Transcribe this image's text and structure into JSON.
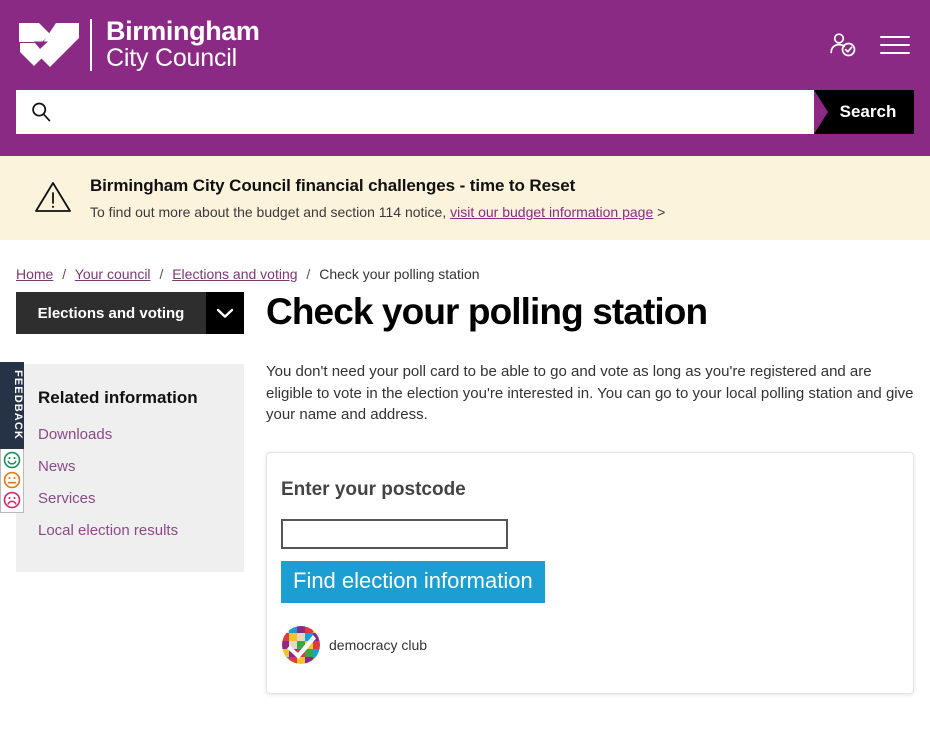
{
  "header": {
    "logo_name": "birmingham-city-council-logo",
    "brand_line1": "Birmingham",
    "brand_line2": "City Council",
    "account_icon": "user-verified-icon",
    "menu_icon": "hamburger-menu-icon"
  },
  "search": {
    "icon": "search-icon",
    "value": "",
    "placeholder": "",
    "button_label": "Search"
  },
  "alert": {
    "icon": "warning-triangle-icon",
    "title": "Birmingham City Council financial challenges - time to Reset",
    "text": "To find out more about the budget and section 114 notice,",
    "link_label": "visit our budget information page",
    "chevron": ">"
  },
  "breadcrumb": {
    "items": [
      {
        "label": "Home",
        "link": true
      },
      {
        "label": "Your council",
        "link": true
      },
      {
        "label": "Elections and voting",
        "link": true
      },
      {
        "label": "Check your polling station",
        "link": false
      }
    ],
    "separator": "/"
  },
  "sidebar": {
    "dropdown": {
      "label": "Elections and voting",
      "toggle_icon": "chevron-down-icon"
    },
    "related": {
      "heading": "Related information",
      "items": [
        {
          "label": "Downloads"
        },
        {
          "label": "News"
        },
        {
          "label": "Services"
        },
        {
          "label": "Local election results"
        }
      ]
    }
  },
  "main": {
    "title": "Check your polling station",
    "intro": "You don't need your poll card to be able to go and vote as long as you're registered and are eligible to vote in the election you're interested in.  You can go to your local polling station and give your name and address.",
    "form": {
      "title": "Enter your postcode",
      "postcode_value": "",
      "postcode_placeholder": "",
      "submit_label": "Find election information",
      "attribution": {
        "logo_name": "democracy-club-logo",
        "label": "democracy club"
      }
    }
  },
  "feedback": {
    "label": "FEEDBACK",
    "faces": [
      {
        "name": "happy-face-icon",
        "color": "#1c8c5a"
      },
      {
        "name": "neutral-face-icon",
        "color": "#e2761a"
      },
      {
        "name": "sad-face-icon",
        "color": "#cf2a6e"
      }
    ]
  },
  "colors": {
    "brand_purple": "#8a2a84",
    "alert_bg": "#fcf3dd",
    "button_blue": "#1b9ed2",
    "sidebar_bg": "#efefef",
    "nav_dark": "#2e2e2e",
    "link_purple": "#8a4a86"
  }
}
